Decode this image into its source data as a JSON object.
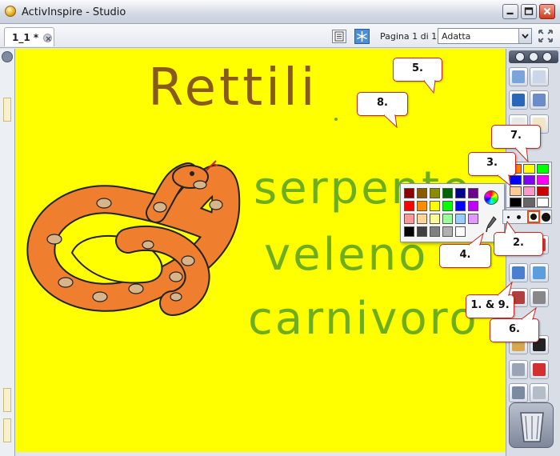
{
  "window": {
    "title": "ActivInspire - Studio"
  },
  "document_tab": {
    "label": "1_1 *"
  },
  "toolbar": {
    "page_indicator": "Pagina 1 di 1",
    "zoom_value": "Adatta"
  },
  "canvas": {
    "title_text": "Rettili",
    "words": [
      "serpente",
      "veleno",
      "carnivoro"
    ],
    "background_color": "#ffff00"
  },
  "callouts": {
    "c1": "1. & 9.",
    "c2": "2.",
    "c3": "3.",
    "c4": "4.",
    "c5": "5.",
    "c6": "6.",
    "c7": "7.",
    "c8": "8."
  },
  "palette_colors": [
    "#8b0000",
    "#8b5a00",
    "#8b8b00",
    "#006400",
    "#00008b",
    "#6a008b",
    "#ff0000",
    "#ff8c00",
    "#ffff00",
    "#00ff00",
    "#0000ff",
    "#c000ff",
    "#ff9999",
    "#ffd59a",
    "#ffff99",
    "#99ff99",
    "#99ccff",
    "#e09aff",
    "#000000",
    "#404040",
    "#808080",
    "#b0b0b0",
    "#ffffff"
  ],
  "toolbox_palette_colors": [
    "#ff8000",
    "#ffff00",
    "#00ff00",
    "#0000ff",
    "#8000ff",
    "#ff00ff",
    "#ffcc99",
    "#ff99cc",
    "#cc0000",
    "#000000",
    "#666666",
    "#ffffff"
  ],
  "icons": {
    "app_logo": "activinspire-logo-icon",
    "minimize": "minimize-icon",
    "maximize": "maximize-icon",
    "close": "close-icon",
    "tab_close": "tab-close-icon",
    "page_sorter": "page-sorter-icon",
    "snowflake": "snowflake-icon",
    "fullscreen": "fullscreen-icon",
    "trash": "trash-icon"
  }
}
